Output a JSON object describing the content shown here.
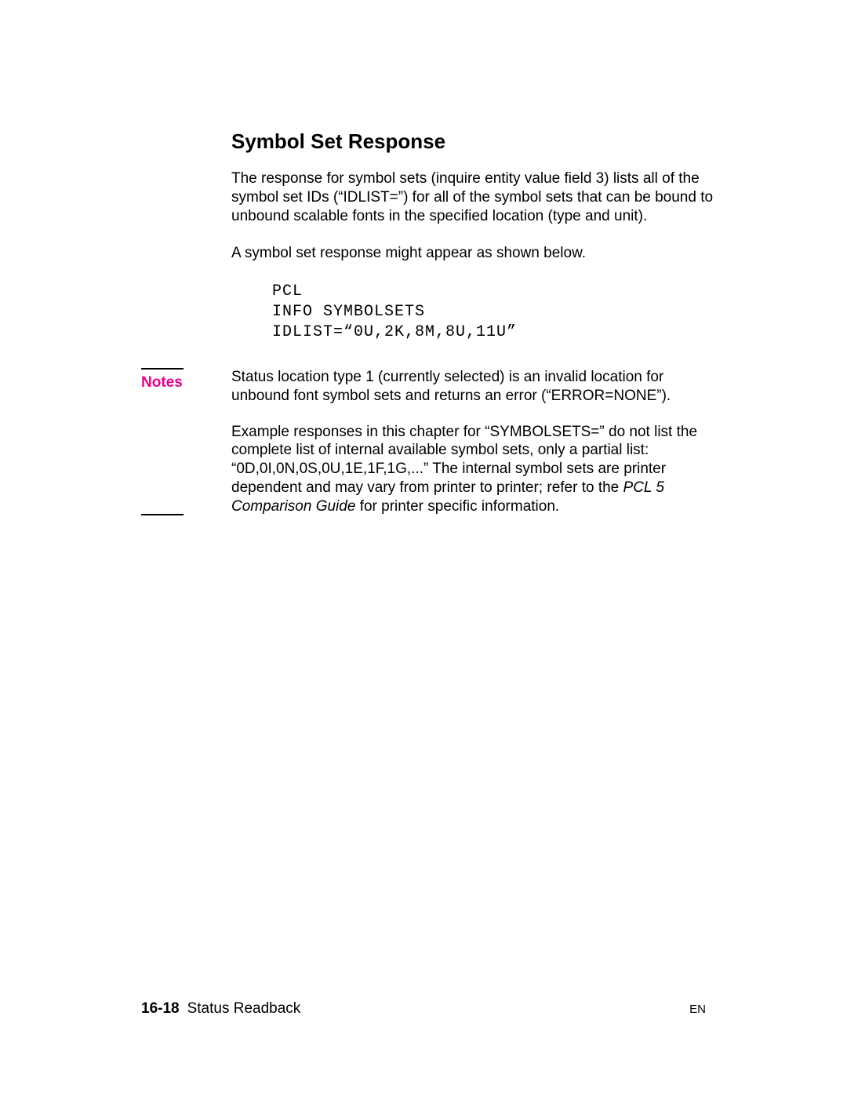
{
  "heading": "Symbol Set Response",
  "para1": "The response for symbol sets (inquire entity value field 3) lists all of the symbol set IDs (“IDLIST=”) for all of the symbol sets that can be bound to unbound scalable fonts in the specified location (type and unit).",
  "para2": "A symbol set response might appear as shown below.",
  "code": "PCL\nINFO SYMBOLSETS\nIDLIST=“0U,2K,8M,8U,11U”",
  "notesLabel": "Notes",
  "note1": "Status location type 1 (currently selected) is an invalid location for unbound font symbol sets and returns an error (“ERROR=NONE”).",
  "note2a": "Example responses in this chapter for “SYMBOLSETS=” do not list the complete list of internal available symbol sets, only a partial list: “0D,0I,0N,0S,0U,1E,1F,1G,...” The internal symbol sets are printer dependent and may vary from printer to printer; refer to the ",
  "note2italic1": "PCL 5 Comparison Guide",
  "note2b": " for printer specific information.",
  "footer": {
    "pageNum": "16-18",
    "section": "Status Readback",
    "lang": "EN"
  }
}
